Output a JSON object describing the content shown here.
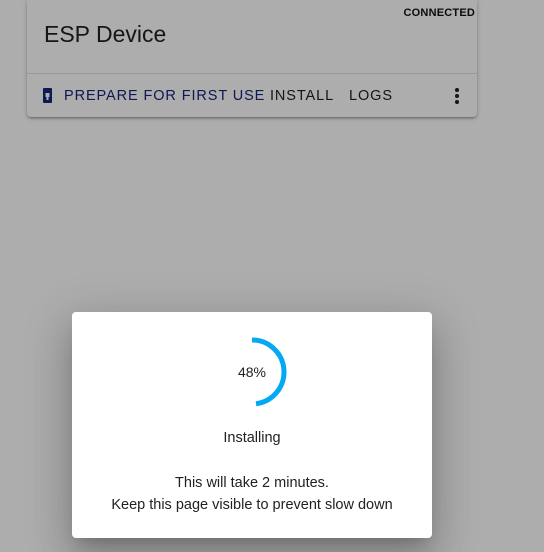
{
  "device_card": {
    "title": "ESP Device",
    "status": "CONNECTED",
    "actions": {
      "prepare_label": "PREPARE FOR FIRST USE",
      "install_label": "INSTALL",
      "logs_label": "LOGS"
    },
    "icons": {
      "prepare": "usb-device-icon",
      "more": "more-vert-icon"
    }
  },
  "install_dialog": {
    "progress_label": "48%",
    "progress_fraction": 0.48,
    "status": "Installing",
    "message_line1": "This will take 2 minutes.",
    "message_line2": "Keep this page visible to prevent slow down"
  },
  "colors": {
    "primary_text": "#1a237e",
    "progress_accent": "#03a9f4"
  }
}
